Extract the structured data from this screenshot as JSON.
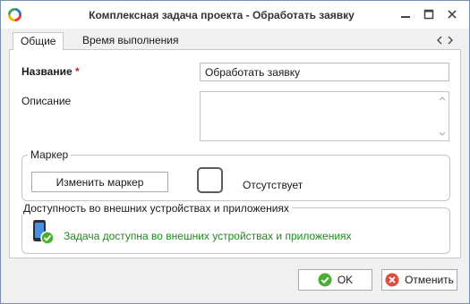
{
  "window": {
    "title": "Комплексная задача проекта - Обработать заявку",
    "controls": [
      "minimize-icon",
      "maximize-icon",
      "close-icon"
    ]
  },
  "tabs": [
    {
      "label": "Общие",
      "active": true
    },
    {
      "label": "Время выполнения",
      "active": false
    }
  ],
  "form": {
    "name_label": "Название",
    "required_mark": "*",
    "name_value": "Обработать заявку",
    "description_label": "Описание",
    "description_value": ""
  },
  "marker": {
    "group_title": "Маркер",
    "change_button": "Изменить маркер",
    "status": "Отсутствует"
  },
  "access": {
    "group_title": "Доступность во внешних устройствах и приложениях",
    "status_text": "Задача доступна во внешних устройствах и приложениях"
  },
  "footer": {
    "ok_label": "OK",
    "cancel_label": "Отменить"
  },
  "colors": {
    "accent_green": "#1e8a1e",
    "required_red": "#c0262d",
    "ok_icon": "#4cae32",
    "cancel_icon": "#e04a3f"
  }
}
